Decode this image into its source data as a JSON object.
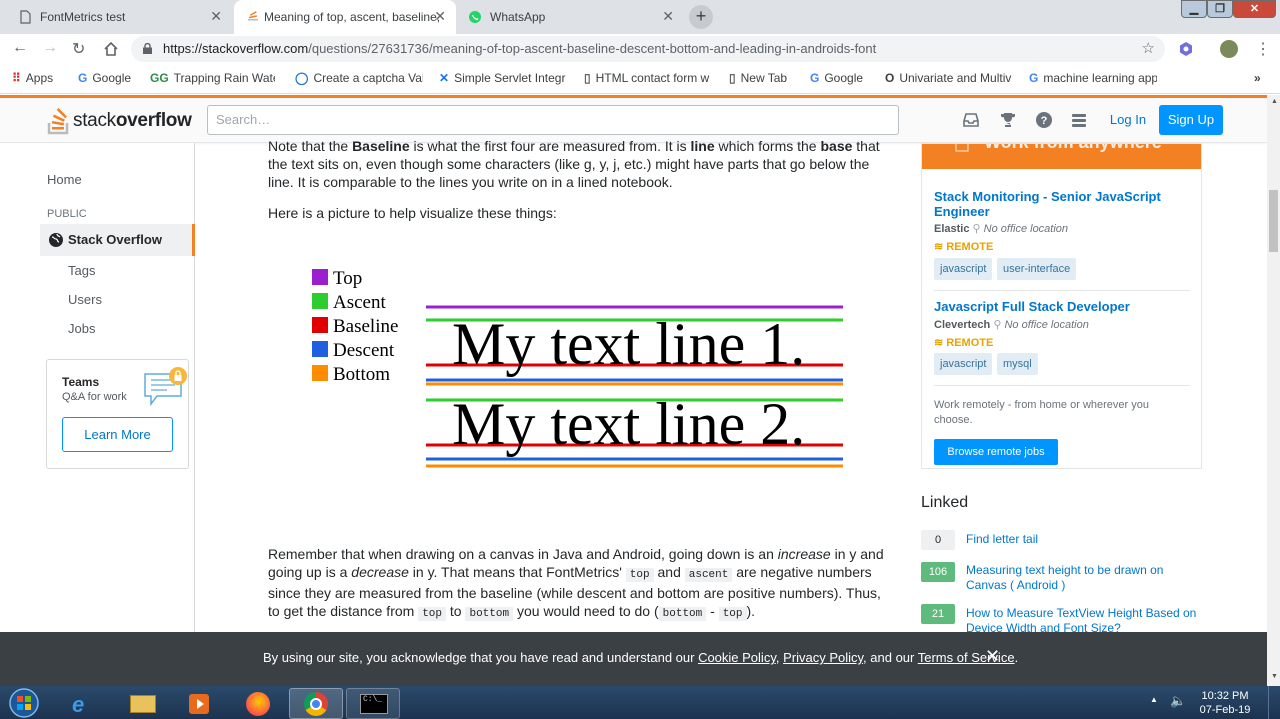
{
  "tabs": [
    {
      "title": "FontMetrics test",
      "icon": "document-icon"
    },
    {
      "title": "Meaning of top, ascent, baseline,",
      "icon": "stackoverflow-icon"
    },
    {
      "title": "WhatsApp",
      "icon": "whatsapp-icon"
    }
  ],
  "toolbar": {
    "url_host": "https://stackoverflow.com",
    "url_path": "/questions/27631736/meaning-of-top-ascent-baseline-descent-bottom-and-leading-in-androids-font"
  },
  "bookmarks": [
    {
      "label": "Apps",
      "icon": "apps-icon"
    },
    {
      "label": "Google",
      "icon": "google-icon"
    },
    {
      "label": "Trapping Rain Water",
      "icon": "gfg-icon"
    },
    {
      "label": "Create a captcha Vali",
      "icon": "circle-icon"
    },
    {
      "label": "Simple Servlet Integr",
      "icon": "x-icon"
    },
    {
      "label": "HTML contact form w",
      "icon": "document-icon"
    },
    {
      "label": "New Tab",
      "icon": "document-icon"
    },
    {
      "label": "Google",
      "icon": "google-icon"
    },
    {
      "label": "Univariate and Multiv",
      "icon": "o-icon"
    },
    {
      "label": "machine learning app",
      "icon": "google-icon"
    }
  ],
  "so_header": {
    "logo_text_1": "stack",
    "logo_text_2": "overflow",
    "search_placeholder": "Search…",
    "login": "Log In",
    "signup": "Sign Up"
  },
  "leftnav": {
    "home": "Home",
    "public": "PUBLIC",
    "stackoverflow": "Stack Overflow",
    "tags": "Tags",
    "users": "Users",
    "jobs": "Jobs",
    "teams_title": "Teams",
    "teams_sub": "Q&A for work",
    "learn_more": "Learn More"
  },
  "main": {
    "p1a": "Note that the ",
    "p1b": "Baseline",
    "p1c": " is what the first four are measured from. It is ",
    "p1d": "line",
    "p1e": " which forms the ",
    "p1f": "base",
    "p1g": " that the text sits on, even though some characters (like g, y, j, etc.) might have parts that go below the line. It is comparable to the lines you write on in a lined notebook.",
    "p2": "Here is a picture to help visualize these things:",
    "legend": [
      {
        "label": "Top",
        "color": "#9b1fcf"
      },
      {
        "label": "Ascent",
        "color": "#2ecc2e"
      },
      {
        "label": "Baseline",
        "color": "#e00000"
      },
      {
        "label": "Descent",
        "color": "#1f5fe0"
      },
      {
        "label": "Bottom",
        "color": "#ff8c00"
      }
    ],
    "line1": "My text line 1.",
    "line2": "My text line 2.",
    "p3a": "Remember that when drawing on a canvas in Java and Android, going down is an ",
    "p3b": "increase",
    "p3c": " in y and going up is a ",
    "p3d": "decrease",
    "p3e": " in y. That means that FontMetrics' ",
    "p3f": "top",
    "p3g": " and ",
    "p3h": "ascent",
    "p3i": " are negative numbers since they are measured from the baseline (while descent and bottom are positive numbers). Thus, to get the distance from ",
    "p3j": "top",
    "p3k": " to ",
    "p3l": "bottom",
    "p3m": " you would need to do (",
    "p3n": "bottom",
    "p3o": " - ",
    "p3p": "top",
    "p3q": ")."
  },
  "rightbar": {
    "banner": "Work from anywhere",
    "jobs": [
      {
        "title": "Stack Monitoring - Senior JavaScript Engineer",
        "company": "Elastic",
        "location": "No office location",
        "remote": "REMOTE",
        "tags": [
          "javascript",
          "user-interface"
        ]
      },
      {
        "title": "Javascript Full Stack Developer",
        "company": "Clevertech",
        "location": "No office location",
        "remote": "REMOTE",
        "tags": [
          "javascript",
          "mysql"
        ]
      }
    ],
    "remote_note": "Work remotely - from home or wherever you choose.",
    "browse": "Browse remote jobs",
    "linked_title": "Linked",
    "linked": [
      {
        "count": "0",
        "title": "Find letter tail"
      },
      {
        "count": "106",
        "title": "Measuring text height to be drawn on Canvas ( Android )"
      },
      {
        "count": "21",
        "title": "How to Measure TextView Height Based on Device Width and Font Size?"
      }
    ]
  },
  "cookie": {
    "a": "By using our site, you acknowledge that you have read and understand our ",
    "cookie_policy": "Cookie Policy",
    "b": ", ",
    "privacy": "Privacy Policy",
    "c": ", and our ",
    "terms": "Terms of Service",
    "d": "."
  },
  "taskbar": {
    "time": "10:32 PM",
    "date": "07-Feb-19"
  },
  "colors": {
    "so_orange": "#f48024",
    "so_blue": "#0095ff",
    "link_blue": "#0077cc"
  }
}
